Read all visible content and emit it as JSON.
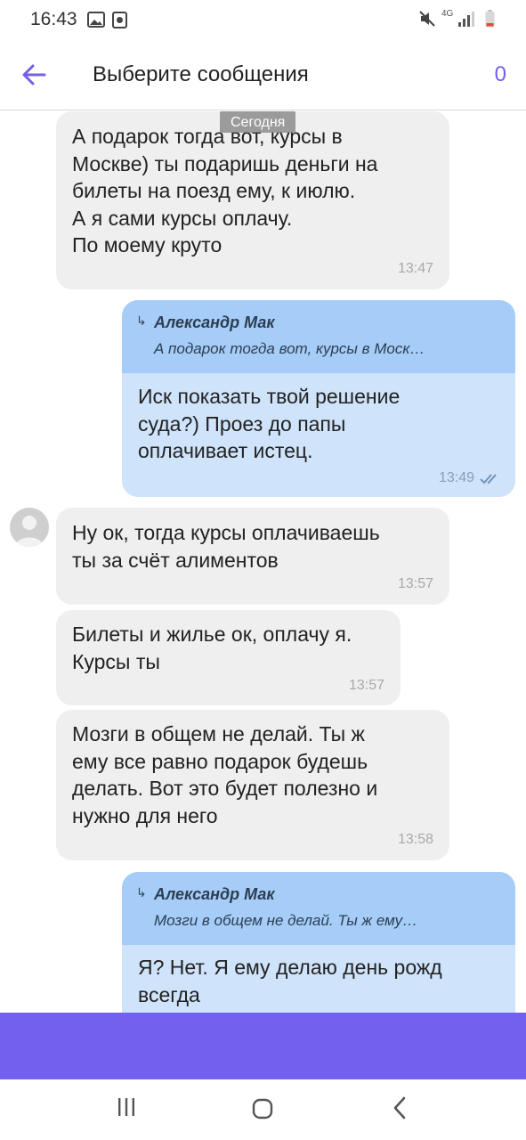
{
  "status_bar": {
    "time": "16:43",
    "net_type": "4G",
    "icons": [
      "gallery-icon",
      "record-icon",
      "mute-icon",
      "signal-icon",
      "battery-icon"
    ]
  },
  "app_bar": {
    "title": "Выберите сообщения",
    "selected_count": "0",
    "accent_color": "#7360e6"
  },
  "chat": {
    "date_separator": "Сегодня",
    "messages": [
      {
        "direction": "in",
        "text": "А подарок тогда вот, курсы в\nМоскве) ты подаришь деньги на\nбилеты на поезд ему, к июлю.\nА я сами курсы оплачу.\nПо моему круто",
        "time": "13:47"
      },
      {
        "direction": "out",
        "reply_author": "Александр Мак",
        "reply_preview": "А подарок тогда вот, курсы в Моск…",
        "text": "Иск показать твой решение\nсуда?) Проез до папы\nоплачивает истец.",
        "time": "13:49"
      },
      {
        "direction": "in",
        "text": "Ну ок, тогда курсы оплачиваешь\nты за счёт алиментов",
        "time": "13:57"
      },
      {
        "direction": "in",
        "text": "Билеты и жилье ок, оплачу я.\nКурсы ты",
        "time": "13:57"
      },
      {
        "direction": "in",
        "text": "Мозги в общем не делай.  Ты ж\nему все равно подарок будешь\nделать.  Вот это будет полезно и\nнужно для него",
        "time": "13:58"
      },
      {
        "direction": "out",
        "reply_author": "Александр Мак",
        "reply_preview": "Мозги в общем не делай.  Ты ж ему…",
        "text": "Я? Нет. Я ему делаю день рожд\nвсегда",
        "time": ""
      }
    ]
  },
  "colors": {
    "incoming_bubble": "#efefef",
    "outgoing_bubble": "#cfe3fb",
    "reply_block": "#a5cdf7",
    "bottom_bar": "#7460ee"
  }
}
